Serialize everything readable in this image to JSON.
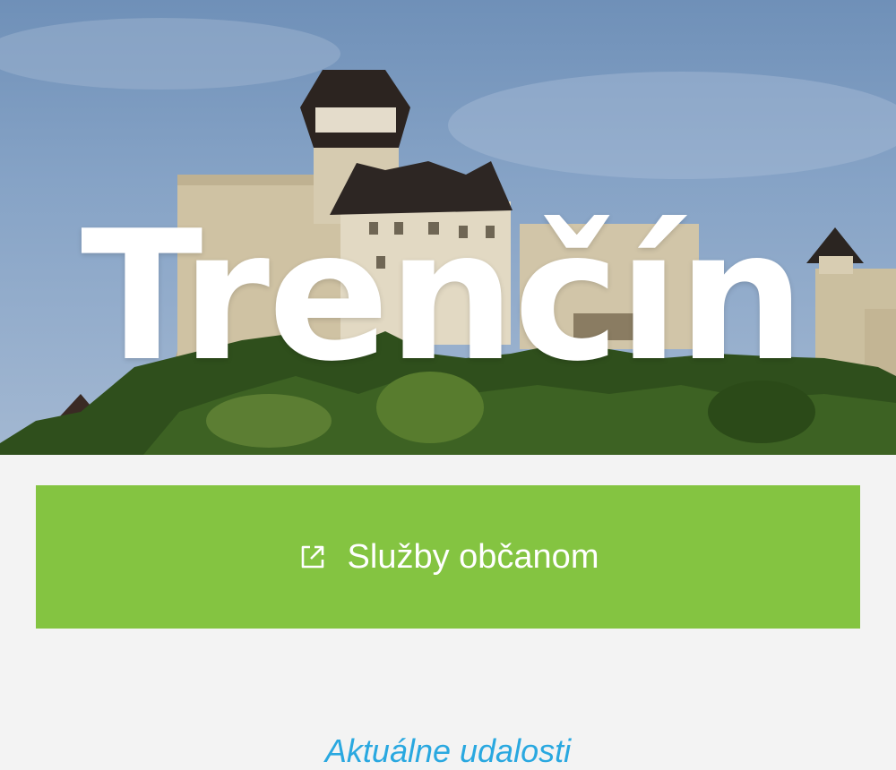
{
  "hero": {
    "title": "Trenčín",
    "image": "trencin-castle-photo"
  },
  "cta": {
    "label": "Služby občanom",
    "icon": "external-link-icon",
    "color": "#84c441"
  },
  "link": {
    "text": "Aktuálne udalosti"
  },
  "colors": {
    "background": "#f3f3f3",
    "accent": "#84c441",
    "link": "#29a8e0"
  }
}
